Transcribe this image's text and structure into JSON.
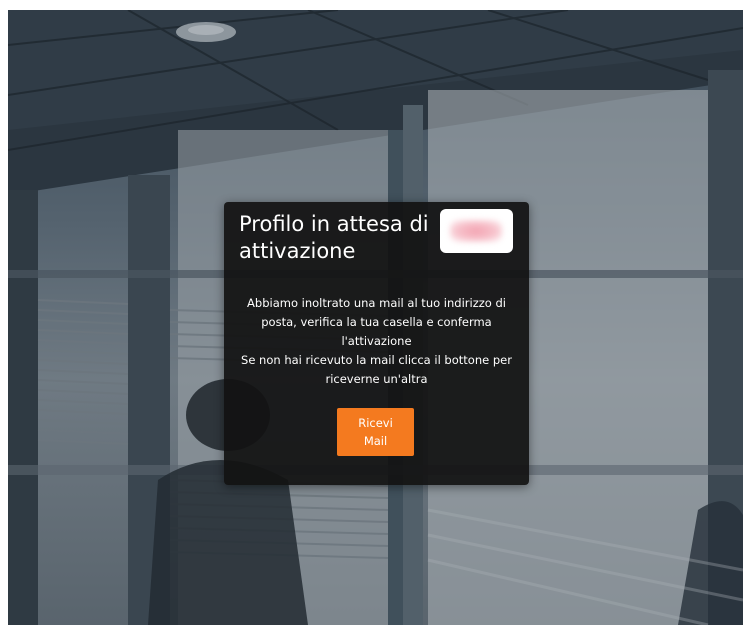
{
  "background": {
    "image_name": "office-window-background"
  },
  "modal": {
    "title": "Profilo in attesa di attivazione",
    "logo_icon": "brand-logo-blurred",
    "message": [
      "Abbiamo inoltrato una mail al tuo indirizzo di posta, verifica la tua casella e conferma l'attivazione",
      "Se non hai ricevuto la mail clicca il bottone per riceverne un'altra"
    ],
    "button_label": "Ricevi Mail"
  },
  "colors": {
    "accent": "#f47a1f",
    "modal_background": "#121212",
    "text": "#ffffff"
  }
}
